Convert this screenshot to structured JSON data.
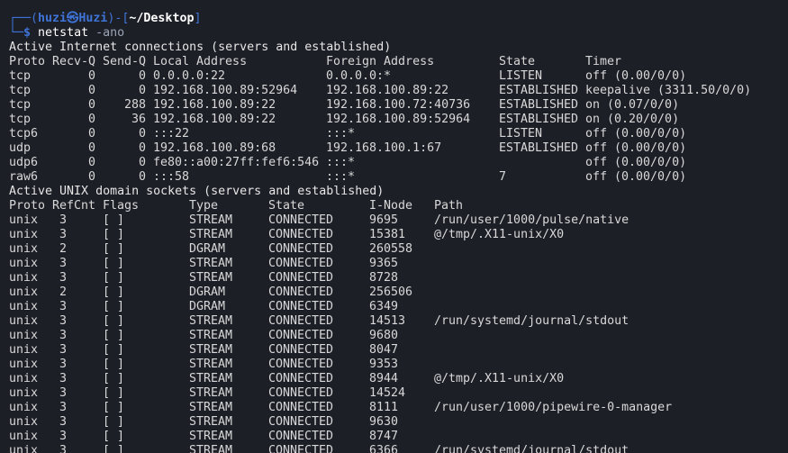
{
  "prompt": {
    "frame_top": "┌──(",
    "user_host": "huzi㉿Huzi",
    "frame_mid": ")-[",
    "cwd": "~/Desktop",
    "frame_end": "]",
    "frame_bottom": "└─",
    "symbol": "$",
    "command": "netstat",
    "args": "-ano"
  },
  "inet_section": {
    "title": "Active Internet connections (servers and established)",
    "headers": [
      "Proto",
      "Recv-Q",
      "Send-Q",
      "Local Address",
      "Foreign Address",
      "State",
      "Timer"
    ],
    "rows": [
      [
        "tcp",
        "0",
        "0",
        "0.0.0.0:22",
        "0.0.0.0:*",
        "LISTEN",
        "off (0.00/0/0)"
      ],
      [
        "tcp",
        "0",
        "0",
        "192.168.100.89:52964",
        "192.168.100.89:22",
        "ESTABLISHED",
        "keepalive (3311.50/0/0)"
      ],
      [
        "tcp",
        "0",
        "288",
        "192.168.100.89:22",
        "192.168.100.72:40736",
        "ESTABLISHED",
        "on (0.07/0/0)"
      ],
      [
        "tcp",
        "0",
        "36",
        "192.168.100.89:22",
        "192.168.100.89:52964",
        "ESTABLISHED",
        "on (0.20/0/0)"
      ],
      [
        "tcp6",
        "0",
        "0",
        ":::22",
        ":::*",
        "LISTEN",
        "off (0.00/0/0)"
      ],
      [
        "udp",
        "0",
        "0",
        "192.168.100.89:68",
        "192.168.100.1:67",
        "ESTABLISHED",
        "off (0.00/0/0)"
      ],
      [
        "udp6",
        "0",
        "0",
        "fe80::a00:27ff:fef6:546",
        ":::*",
        "",
        "off (0.00/0/0)"
      ],
      [
        "raw6",
        "0",
        "0",
        ":::58",
        ":::*",
        "7",
        "off (0.00/0/0)"
      ]
    ]
  },
  "unix_section": {
    "title": "Active UNIX domain sockets (servers and established)",
    "headers": [
      "Proto",
      "RefCnt",
      "Flags",
      "Type",
      "State",
      "I-Node",
      "Path"
    ],
    "rows": [
      [
        "unix",
        "3",
        "[ ]",
        "STREAM",
        "CONNECTED",
        "9695",
        "/run/user/1000/pulse/native"
      ],
      [
        "unix",
        "3",
        "[ ]",
        "STREAM",
        "CONNECTED",
        "15381",
        "@/tmp/.X11-unix/X0"
      ],
      [
        "unix",
        "2",
        "[ ]",
        "DGRAM",
        "CONNECTED",
        "260558",
        ""
      ],
      [
        "unix",
        "3",
        "[ ]",
        "STREAM",
        "CONNECTED",
        "9365",
        ""
      ],
      [
        "unix",
        "3",
        "[ ]",
        "STREAM",
        "CONNECTED",
        "8728",
        ""
      ],
      [
        "unix",
        "2",
        "[ ]",
        "DGRAM",
        "CONNECTED",
        "256506",
        ""
      ],
      [
        "unix",
        "3",
        "[ ]",
        "DGRAM",
        "CONNECTED",
        "6349",
        ""
      ],
      [
        "unix",
        "3",
        "[ ]",
        "STREAM",
        "CONNECTED",
        "14513",
        "/run/systemd/journal/stdout"
      ],
      [
        "unix",
        "3",
        "[ ]",
        "STREAM",
        "CONNECTED",
        "9680",
        ""
      ],
      [
        "unix",
        "3",
        "[ ]",
        "STREAM",
        "CONNECTED",
        "8047",
        ""
      ],
      [
        "unix",
        "3",
        "[ ]",
        "STREAM",
        "CONNECTED",
        "9353",
        ""
      ],
      [
        "unix",
        "3",
        "[ ]",
        "STREAM",
        "CONNECTED",
        "8944",
        "@/tmp/.X11-unix/X0"
      ],
      [
        "unix",
        "3",
        "[ ]",
        "STREAM",
        "CONNECTED",
        "14524",
        ""
      ],
      [
        "unix",
        "3",
        "[ ]",
        "STREAM",
        "CONNECTED",
        "8111",
        "/run/user/1000/pipewire-0-manager"
      ],
      [
        "unix",
        "3",
        "[ ]",
        "STREAM",
        "CONNECTED",
        "9630",
        ""
      ],
      [
        "unix",
        "3",
        "[ ]",
        "STREAM",
        "CONNECTED",
        "8747",
        ""
      ],
      [
        "unix",
        "3",
        "[ ]",
        "STREAM",
        "CONNECTED",
        "6366",
        "/run/systemd/journal/stdout"
      ]
    ]
  },
  "colors": {
    "background": "#1d1f27",
    "prompt_accent": "#3e74d8",
    "text": "#d8d8d8"
  }
}
